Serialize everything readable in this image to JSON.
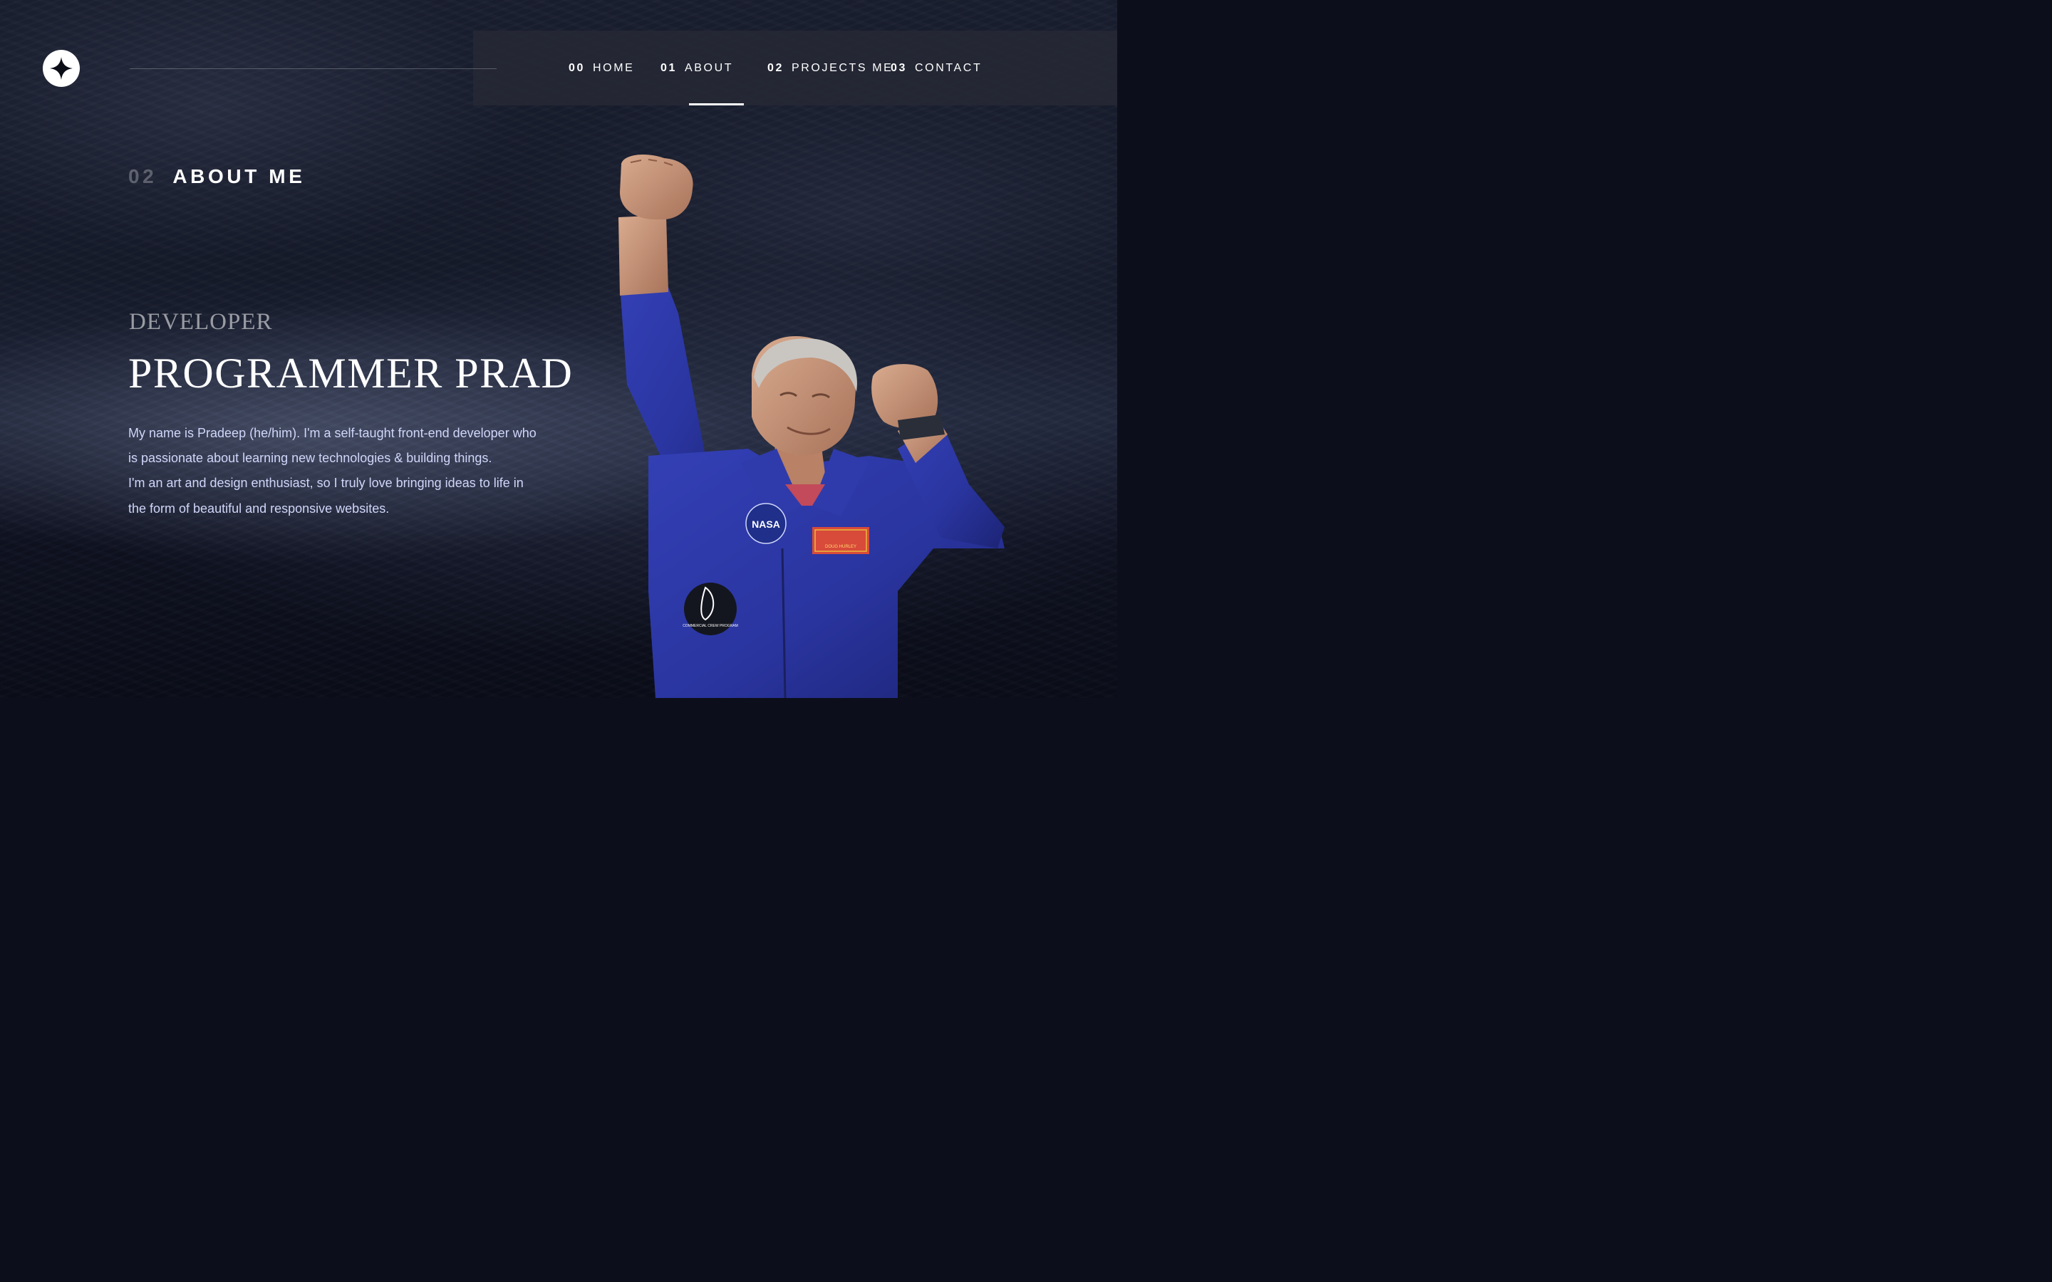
{
  "logo": {
    "icon": "four-point-star-icon"
  },
  "nav": {
    "items": [
      {
        "num": "00",
        "label": "HOME",
        "active": false
      },
      {
        "num": "01",
        "label": "ABOUT",
        "active": true
      },
      {
        "num": "02",
        "label": "PROJECTS ME",
        "active": false
      },
      {
        "num": "03",
        "label": "CONTACT",
        "active": false
      }
    ]
  },
  "section": {
    "num": "02",
    "label": "ABOUT ME"
  },
  "hero": {
    "subtitle": "DEVELOPER",
    "title": "PROGRAMMER PRAD",
    "bio_1": "My name is Pradeep (he/him). I'm a self-taught front-end developer who is passionate about learning new technologies & building things.",
    "bio_2": "I'm an art and design enthusiast, so I truly love bringing ideas to life in the form of beautiful and responsive websites."
  },
  "image": {
    "subject": "astronaut-celebrating",
    "patch_nasa": "NASA",
    "patch_name": "DOUG HURLEY",
    "patch_crew": "COMMERCIAL CREW PROGRAM"
  },
  "colors": {
    "background": "#0b0d17",
    "accent": "#ffffff",
    "body_text": "#d0d6f9",
    "suit_blue": "#2a35a0"
  }
}
